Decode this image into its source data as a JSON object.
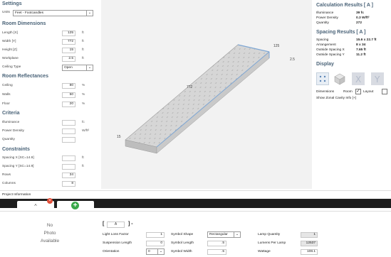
{
  "settings": {
    "title": "Settings",
    "units_label": "Units",
    "units_value": "Feet - Footcandles"
  },
  "room_dimensions": {
    "title": "Room Dimensions",
    "length_label": "Length [X]",
    "length_value": "125",
    "length_unit": "ft",
    "width_label": "Width [Y]",
    "width_value": "772",
    "width_unit": "ft",
    "height_label": "Height [Z]",
    "height_value": "15",
    "height_unit": "ft",
    "workplane_label": "Workplane",
    "workplane_value": "2.5",
    "workplane_unit": "ft",
    "ceiling_type_label": "Ceiling Type",
    "ceiling_type_value": "Open"
  },
  "room_reflectances": {
    "title": "Room Reflectances",
    "ceiling_label": "Ceiling",
    "ceiling_value": "80",
    "ceiling_unit": "%",
    "walls_label": "Walls",
    "walls_value": "50",
    "walls_unit": "%",
    "floor_label": "Floor",
    "floor_value": "20",
    "floor_unit": "%"
  },
  "criteria": {
    "title": "Criteria",
    "illuminance_label": "Illuminance",
    "illuminance_value": "",
    "illuminance_unit": "fc",
    "power_density_label": "Power Density",
    "power_density_value": "",
    "power_density_unit": "W/ft²",
    "quantity_label": "Quantity",
    "quantity_value": ""
  },
  "constraints": {
    "title": "Constraints",
    "spacing_x_label": "Spacing X  [SC=14.9]",
    "spacing_x_value": "",
    "spacing_x_unit": "ft",
    "spacing_y_label": "Spacing Y  [SC=14.9]",
    "spacing_y_value": "",
    "spacing_y_unit": "ft",
    "rows_label": "Rows",
    "rows_value": "34",
    "columns_label": "Columns",
    "columns_value": "8"
  },
  "viewport": {
    "dim_length": "125",
    "dim_width": "772",
    "dim_height": "15",
    "dim_workplane": "2.5"
  },
  "calculation_results": {
    "title": "Calculation Results  [ A ]",
    "illuminance_label": "Illuminance",
    "illuminance_value": "39  fc",
    "power_density_label": "Power Density",
    "power_density_value": "0.3  W/ft²",
    "quantity_label": "Quantity",
    "quantity_value": "272"
  },
  "spacing_results": {
    "title": "Spacing Results    [ A ]",
    "spacing_label": "Spacing",
    "spacing_value": "15.6 x 22.7  ft",
    "arrangement_label": "Arrangement",
    "arrangement_value": "8 x 34",
    "outside_x_label": "Outside Spacing X",
    "outside_x_value": "7.65  ft",
    "outside_y_label": "Outside Spacing Y",
    "outside_y_value": "11.2  ft"
  },
  "display": {
    "title": "Display",
    "dimensions_label": "Dimensions",
    "room_label": "Room",
    "layout_label": "Layout",
    "room_checked": true,
    "layout_checked": false,
    "zonal_link": "Show Zonal Cavity Info [+]"
  },
  "project": {
    "title": "Project Information",
    "tab_label": "A"
  },
  "fixture": {
    "no_photo": "No",
    "no_photo2": "Photo",
    "no_photo3": "Available",
    "bracket_open": "[",
    "bracket_value": "A",
    "bracket_close": "] -",
    "llf_label": "Light Loss Factor",
    "llf_value": "1",
    "suspension_label": "Suspension Length",
    "suspension_value": "0",
    "orientation_label": "Orientation",
    "orientation_value": "0",
    "shape_label": "Symbol Shape",
    "shape_value": "Rectangular",
    "symbol_length_label": "Symbol Length",
    "symbol_length_value": ".5",
    "symbol_width_label": "Symbol Width",
    "symbol_width_value": ".5",
    "lamp_qty_label": "Lamp Quantity",
    "lamp_qty_value": "1",
    "lumens_label": "Lumens Per Lamp",
    "lumens_value": "12537",
    "wattage_label": "Wattage",
    "wattage_value": "108.1"
  },
  "colors": {
    "section_title": "#4a6378",
    "tab_bar": "#1e1e1e",
    "add_tab": "#3aa84a",
    "close_badge": "#e2503a",
    "room_edge": "#7fa7d4"
  }
}
